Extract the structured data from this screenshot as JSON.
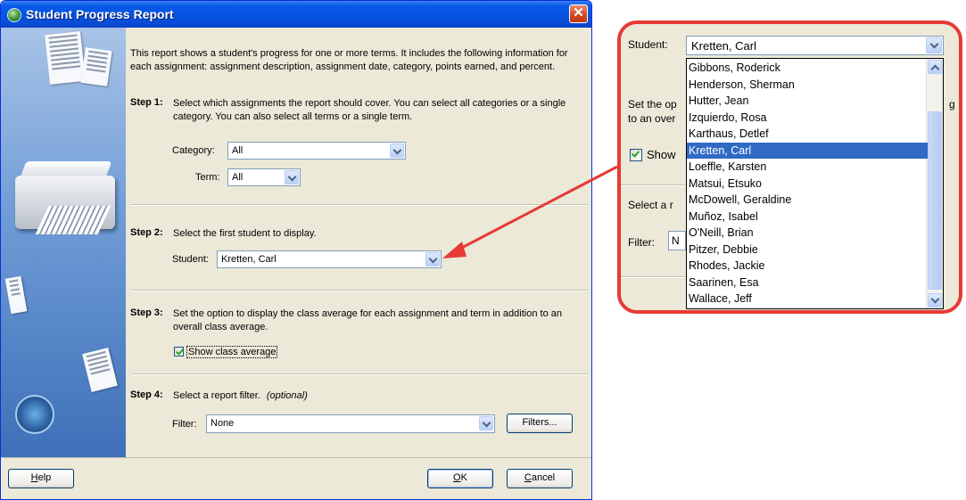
{
  "window": {
    "title": "Student Progress Report",
    "close_symbol": "✕"
  },
  "intro": "This report shows a student's progress for one or more terms.  It includes the following information for each assignment: assignment description, assignment date, category, points earned, and percent.",
  "step1": {
    "label": "Step 1:",
    "text": "Select which assignments the report should cover. You can select all categories or a single category.  You can also select all terms or a single term.",
    "category_label": "Category:",
    "category_value": "All",
    "term_label": "Term:",
    "term_value": "All"
  },
  "step2": {
    "label": "Step 2:",
    "text": "Select the first student to display.",
    "student_label": "Student:",
    "student_value": "Kretten, Carl"
  },
  "step3": {
    "label": "Step 3:",
    "text": "Set the option to display the class average for each assignment and term in addition to an overall class average.",
    "checkbox_label": "Show class average",
    "checked": true
  },
  "step4": {
    "label": "Step 4:",
    "text": "Select a report filter.",
    "optional": "(optional)",
    "filter_label": "Filter:",
    "filter_value": "None",
    "filters_button": "Filters..."
  },
  "buttons": {
    "help_u": "H",
    "help_rest": "elp",
    "ok_u": "O",
    "ok_rest": "K",
    "cancel_u": "C",
    "cancel_rest": "ancel"
  },
  "zoom": {
    "student_label": "Student:",
    "student_value": "Kretten, Carl",
    "behind_text_1": "Set the op",
    "behind_text_2": "to an over",
    "behind_text_right": "g",
    "behind_show": "Show",
    "behind_select": "Select a r",
    "behind_filter": "Filter:",
    "behind_filter_value": "N",
    "students": [
      "Gibbons, Roderick",
      "Henderson, Sherman",
      "Hutter, Jean",
      "Izquierdo, Rosa",
      "Karthaus, Detlef",
      "Kretten, Carl",
      "Loeffle, Karsten",
      "Matsui, Etsuko",
      "McDowell, Geraldine",
      "Muñoz, Isabel",
      "O'Neill, Brian",
      "Pitzer, Debbie",
      "Rhodes, Jackie",
      "Saarinen, Esa",
      "Wallace, Jeff"
    ],
    "selected_index": 5
  },
  "colors": {
    "accent_red": "#e63a35",
    "selection_blue": "#316ac5",
    "xp_title_blue": "#0553e0"
  },
  "icons": [
    "app-icon",
    "close-icon",
    "chevron-down-icon",
    "checkbox-icon",
    "printer-icon"
  ]
}
